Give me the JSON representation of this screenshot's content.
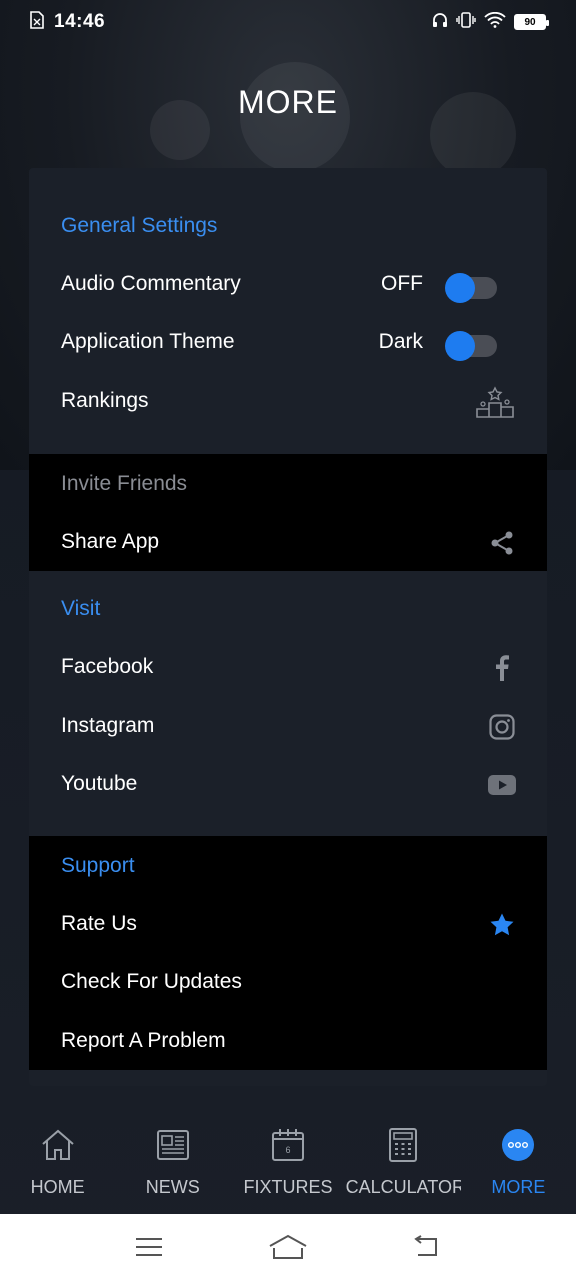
{
  "status_bar": {
    "time": "14:46",
    "battery": "90"
  },
  "page": {
    "title": "MORE"
  },
  "general_settings": {
    "header": "General Settings",
    "audio_commentary": {
      "label": "Audio Commentary",
      "value": "OFF"
    },
    "application_theme": {
      "label": "Application Theme",
      "value": "Dark"
    },
    "rankings": {
      "label": "Rankings"
    }
  },
  "invite_friends": {
    "header": "Invite Friends",
    "share_app": {
      "label": "Share App"
    }
  },
  "visit": {
    "header": "Visit",
    "facebook": {
      "label": "Facebook"
    },
    "instagram": {
      "label": "Instagram"
    },
    "youtube": {
      "label": "Youtube"
    }
  },
  "support": {
    "header": "Support",
    "rate_us": {
      "label": "Rate Us"
    },
    "check_updates": {
      "label": "Check For Updates"
    },
    "report_problem": {
      "label": "Report A Problem"
    }
  },
  "bottom_nav": {
    "items": [
      {
        "label": "HOME",
        "icon": "home-icon"
      },
      {
        "label": "NEWS",
        "icon": "newspaper-icon"
      },
      {
        "label": "FIXTURES",
        "icon": "calendar-icon"
      },
      {
        "label": "CALCULATOR",
        "icon": "calculator-icon"
      },
      {
        "label": "MORE",
        "icon": "more-dots-icon"
      }
    ],
    "active": "MORE"
  },
  "colors": {
    "accent": "#2a86f2",
    "card": "#1b2029",
    "toggle_thumb": "#1e7cf0"
  }
}
